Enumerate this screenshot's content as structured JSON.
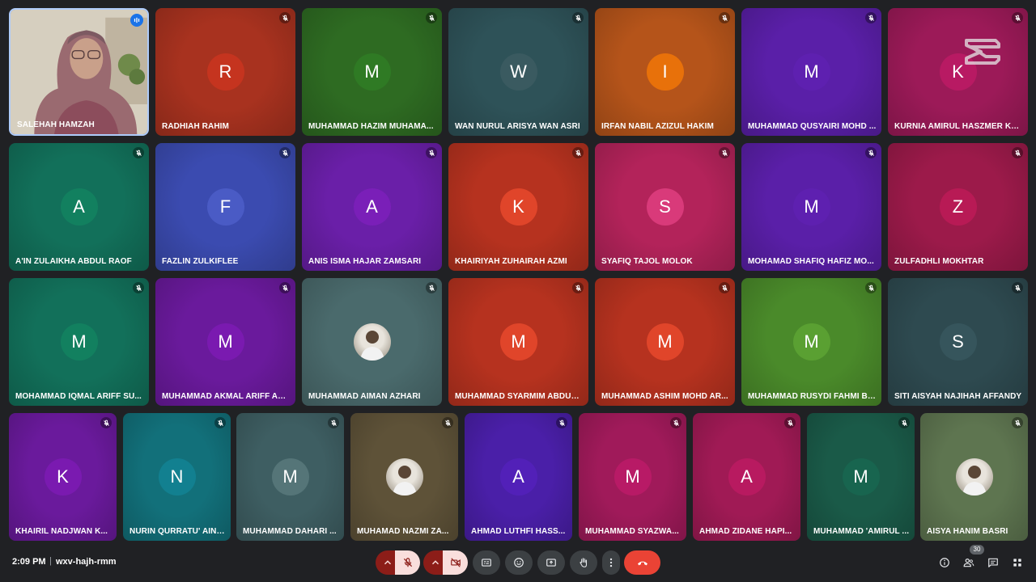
{
  "participants": [
    {
      "name": "SALEHAH HAMZAH",
      "initial": "",
      "self": true
    },
    {
      "name": "RADHIAH RAHIM",
      "initial": "R",
      "bg": "#a8321f",
      "av": "#c5341f"
    },
    {
      "name": "MUHAMMAD HAZIM MUHAMA...",
      "initial": "M",
      "bg": "#2e6b22",
      "av": "#2f7a24"
    },
    {
      "name": "WAN NURUL ARISYA WAN ASRI",
      "initial": "W",
      "bg": "#2e5258",
      "av": "#3a5a60"
    },
    {
      "name": "IRFAN NABIL AZIZUL HAKIM",
      "initial": "I",
      "bg": "#b5541a",
      "av": "#e8710a"
    },
    {
      "name": "MUHAMMAD QUSYAIRI MOHD ...",
      "initial": "M",
      "bg": "#5a1fa8",
      "av": "#5e20b0"
    },
    {
      "name": "KURNIA AMIRUL HASZMER KU...",
      "initial": "K",
      "bg": "#9c1a58",
      "av": "#b81a63"
    },
    {
      "name": "A'IN ZULAIKHA ABDUL RAOF",
      "initial": "A",
      "bg": "#12705a",
      "av": "#12805f"
    },
    {
      "name": "FAZLIN ZULKIFLEE",
      "initial": "F",
      "bg": "#3b4bb0",
      "av": "#4a5bc5"
    },
    {
      "name": "ANIS ISMA HAJAR ZAMSARI",
      "initial": "A",
      "bg": "#6a1fa8",
      "av": "#7a1fb8"
    },
    {
      "name": "KHAIRIYAH ZUHAIRAH AZMI",
      "initial": "K",
      "bg": "#b6321f",
      "av": "#e0452a"
    },
    {
      "name": "SYAFIQ TAJOL MOLOK",
      "initial": "S",
      "bg": "#b3235a",
      "av": "#d93a7a"
    },
    {
      "name": "MOHAMAD SHAFIQ HAFIZ MO...",
      "initial": "M",
      "bg": "#5a1fa8",
      "av": "#5e20b0"
    },
    {
      "name": "ZULFADHLI MOKHTAR",
      "initial": "Z",
      "bg": "#9c1a4a",
      "av": "#b81a55"
    },
    {
      "name": "MOHAMMAD IQMAL ARIFF SU...",
      "initial": "M",
      "bg": "#12705a",
      "av": "#12805f"
    },
    {
      "name": "MUHAMMAD AKMAL ARIFF AB...",
      "initial": "M",
      "bg": "#6a1a9c",
      "av": "#7a1ab0"
    },
    {
      "name": "MUHAMMAD AIMAN AZHARI",
      "initial": "",
      "bg": "#4a6a6c",
      "av": "",
      "photo": true
    },
    {
      "name": "MUHAMMAD SYARMIM ABDUL ...",
      "initial": "M",
      "bg": "#b6321f",
      "av": "#e0452a"
    },
    {
      "name": "MUHAMMAD ASHIM MOHD AR...",
      "initial": "M",
      "bg": "#b6321f",
      "av": "#e0452a"
    },
    {
      "name": "MUHAMMAD RUSYDI FAHMI BI...",
      "initial": "M",
      "bg": "#4a8a2a",
      "av": "#5aa032"
    },
    {
      "name": "SITI AISYAH NAJIHAH AFFANDY",
      "initial": "S",
      "bg": "#2e4a50",
      "av": "#36555c"
    },
    {
      "name": "KHAIRIL NADJWAN K...",
      "initial": "K",
      "bg": "#6a1a9c",
      "av": "#7a1ab0"
    },
    {
      "name": "NURIN QURRATU' AINI ...",
      "initial": "N",
      "bg": "#12707a",
      "av": "#128090"
    },
    {
      "name": "MUHAMMAD DAHARI ...",
      "initial": "M",
      "bg": "#3e5e62",
      "av": "#557578"
    },
    {
      "name": "MUHAMAD NAZMI ZA...",
      "initial": "",
      "bg": "#5e5238",
      "av": "",
      "photo": true
    },
    {
      "name": "AHMAD LUTHFI HASS...",
      "initial": "A",
      "bg": "#4a1fa8",
      "av": "#5220b8"
    },
    {
      "name": "MUHAMMAD SYAZWA...",
      "initial": "M",
      "bg": "#a01a5a",
      "av": "#b81a66"
    },
    {
      "name": "AHMAD ZIDANE HAPI...",
      "initial": "A",
      "bg": "#a01a55",
      "av": "#b81a60"
    },
    {
      "name": "MUHAMMAD 'AMIRUL ...",
      "initial": "M",
      "bg": "#1a5a48",
      "av": "#18654f"
    },
    {
      "name": "AISYA HANIM BASRI",
      "initial": "",
      "bg": "#5e7550",
      "av": "",
      "photo": true
    }
  ],
  "bottombar": {
    "time": "2:09 PM",
    "separator": "|",
    "meeting_code": "wxv-hajh-rmm",
    "people_count": "30"
  },
  "icons": {
    "mic_off": "mic-off-icon",
    "cam_off": "videocam-off-icon",
    "captions": "closed-caption-icon",
    "emoji": "emoji-icon",
    "present": "present-screen-icon",
    "hand": "raise-hand-icon",
    "more": "more-vert-icon",
    "leave": "call-end-icon",
    "info": "info-icon",
    "people": "people-icon",
    "chat": "chat-icon",
    "activities": "activities-icon"
  }
}
